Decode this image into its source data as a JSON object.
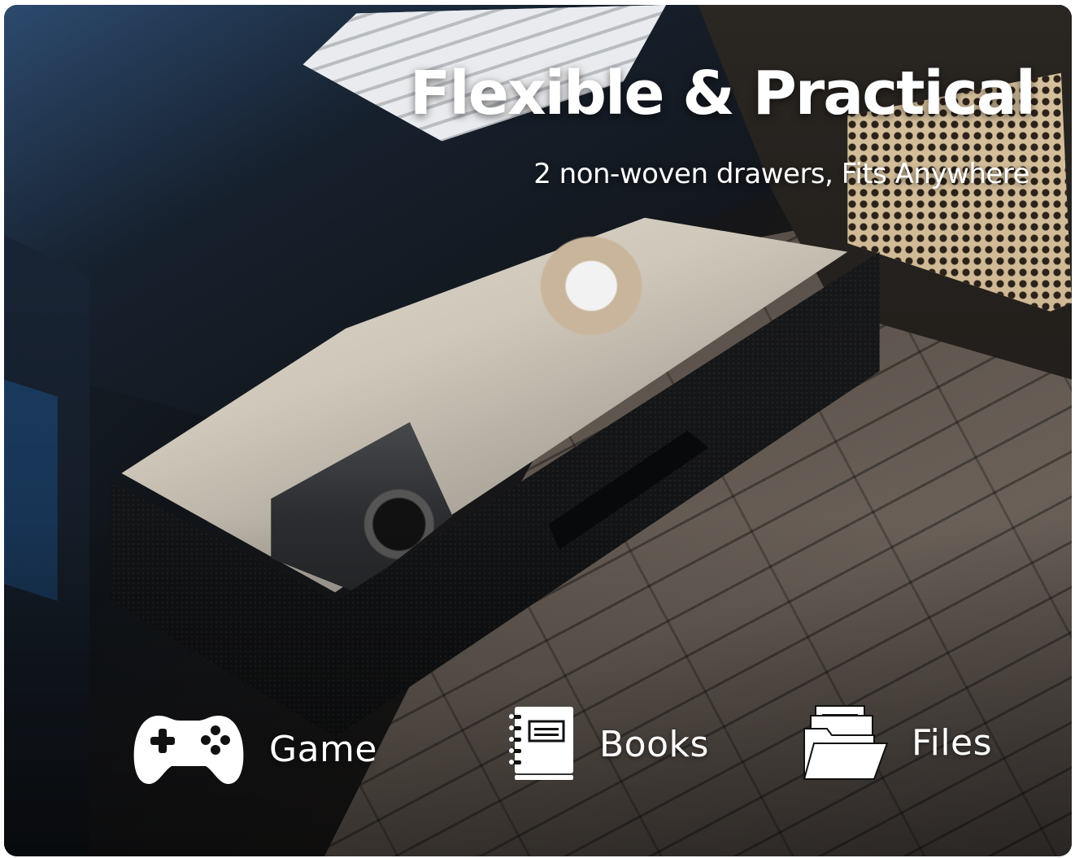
{
  "headline": "Flexible & Practical",
  "subheadline": "2 non-woven drawers, Fits Anywhere",
  "features": [
    {
      "icon": "gamepad-icon",
      "label": "Game"
    },
    {
      "icon": "book-icon",
      "label": "Books"
    },
    {
      "icon": "folder-files-icon",
      "label": "Files"
    }
  ],
  "colors": {
    "text": "#ffffff",
    "desk": "#121417",
    "accent_light": "#2c4a6e"
  }
}
